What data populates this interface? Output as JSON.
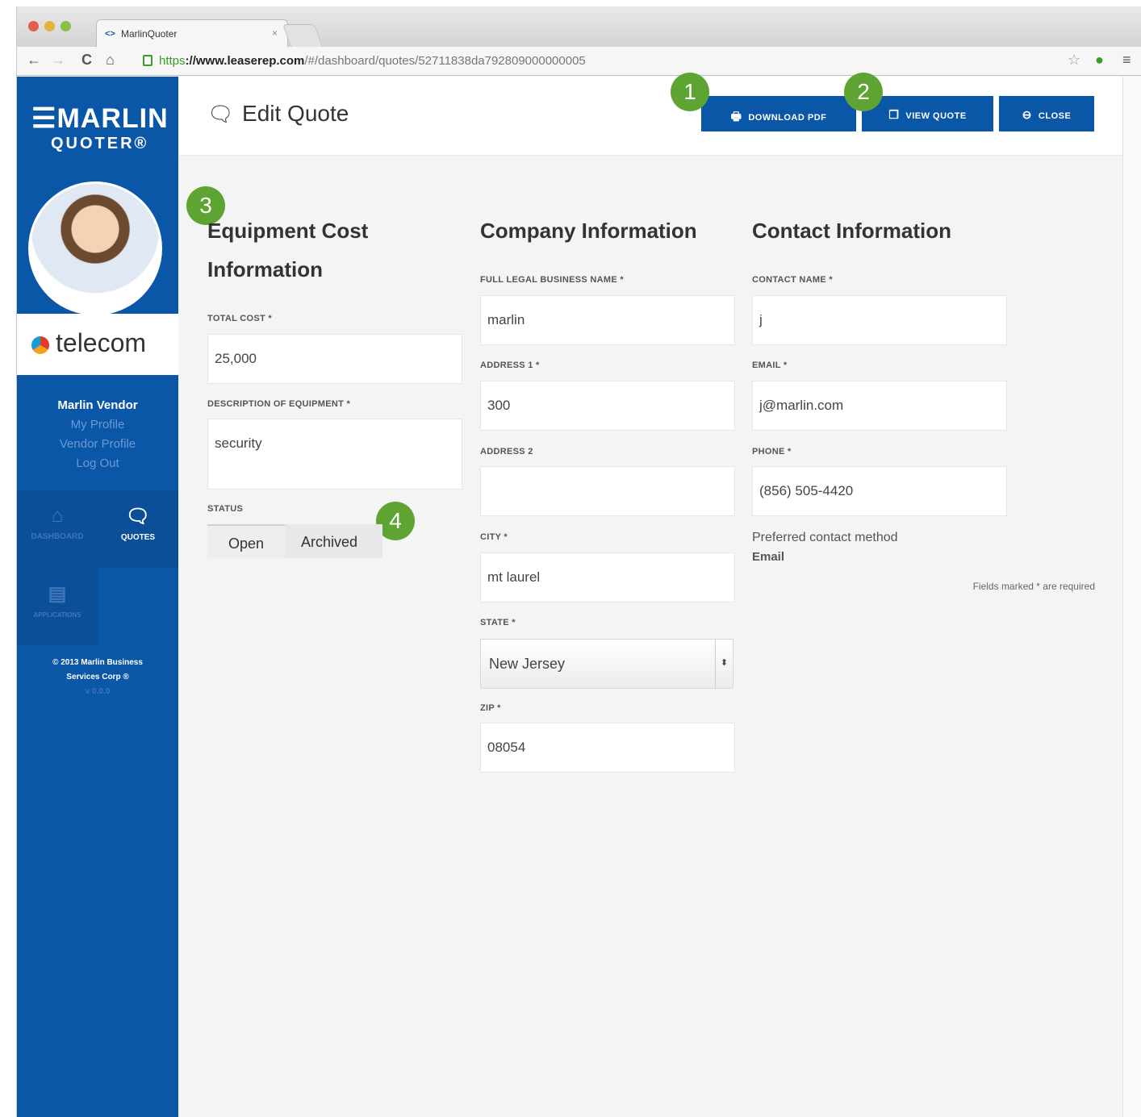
{
  "browser": {
    "tab_title": "MarlinQuoter",
    "tab_favicon": "marlin-favicon",
    "url_scheme": "https",
    "url_domain": "://www.leaserep.com",
    "url_path": "/#/dashboard/quotes/52711838da792809000000005",
    "back_icon": "←",
    "forward_icon": "→",
    "reload_icon": "C",
    "home_icon": "⌂"
  },
  "sidebar": {
    "logo_main": "☰MARLIN",
    "logo_sub": "QUOTER®",
    "brand": "telecom",
    "user_name": "Marlin Vendor",
    "links": [
      "My Profile",
      "Vendor Profile",
      "Log Out"
    ],
    "nav": [
      {
        "icon": "home-icon",
        "glyph": "⌂",
        "label": "DASHBOARD"
      },
      {
        "icon": "chat-icon",
        "glyph": "💬",
        "label": "QUOTES"
      },
      {
        "icon": "document-icon",
        "glyph": "▤",
        "label": "APPLICATIONS"
      }
    ],
    "copyright_lines": [
      "© 2013 Marlin Business",
      "Services Corp ®",
      "v 0.0.0"
    ]
  },
  "header": {
    "title": "Edit Quote",
    "title_icon": "chat-icon",
    "buttons": [
      {
        "label": "Download PDF",
        "icon": "printer-icon",
        "glyph": "🖶"
      },
      {
        "label": "View Quote",
        "icon": "copy-icon",
        "glyph": "❐"
      },
      {
        "label": "Close",
        "icon": "close-circle-icon",
        "glyph": "⊖"
      }
    ]
  },
  "badges": [
    "1",
    "2",
    "3",
    "4"
  ],
  "equipment": {
    "title": "Equipment Cost Information",
    "title_line1": "Equipment Cost",
    "title_line2": "Information",
    "total_cost_label": "TOTAL COST *",
    "total_cost": "25,000",
    "description_label": "DESCRIPTION OF EQUIPMENT *",
    "description": "security",
    "status_label": "STATUS",
    "status_options": [
      "Open",
      "Archived"
    ]
  },
  "company": {
    "title": "Company Information",
    "name_label": "FULL LEGAL BUSINESS NAME *",
    "name": "marlin",
    "address1_label": "ADDRESS 1 *",
    "address1": "300",
    "address2_label": "ADDRESS 2",
    "address2": "",
    "city_label": "CITY *",
    "city": "mt laurel",
    "state_label": "STATE *",
    "state": "New Jersey",
    "zip_label": "ZIP *",
    "zip": "08054"
  },
  "contact": {
    "title": "Contact Information",
    "name_label": "CONTACT NAME *",
    "name": "j",
    "email_label": "EMAIL *",
    "email": "j@marlin.com",
    "phone_label": "PHONE *",
    "phone": "(856) 505-4420",
    "preferred_label": "Preferred contact method",
    "preferred_value": "Email",
    "required_note": "Fields marked * are required"
  },
  "colors": {
    "brand_blue": "#0a56a7",
    "badge_green": "#5ea432"
  }
}
